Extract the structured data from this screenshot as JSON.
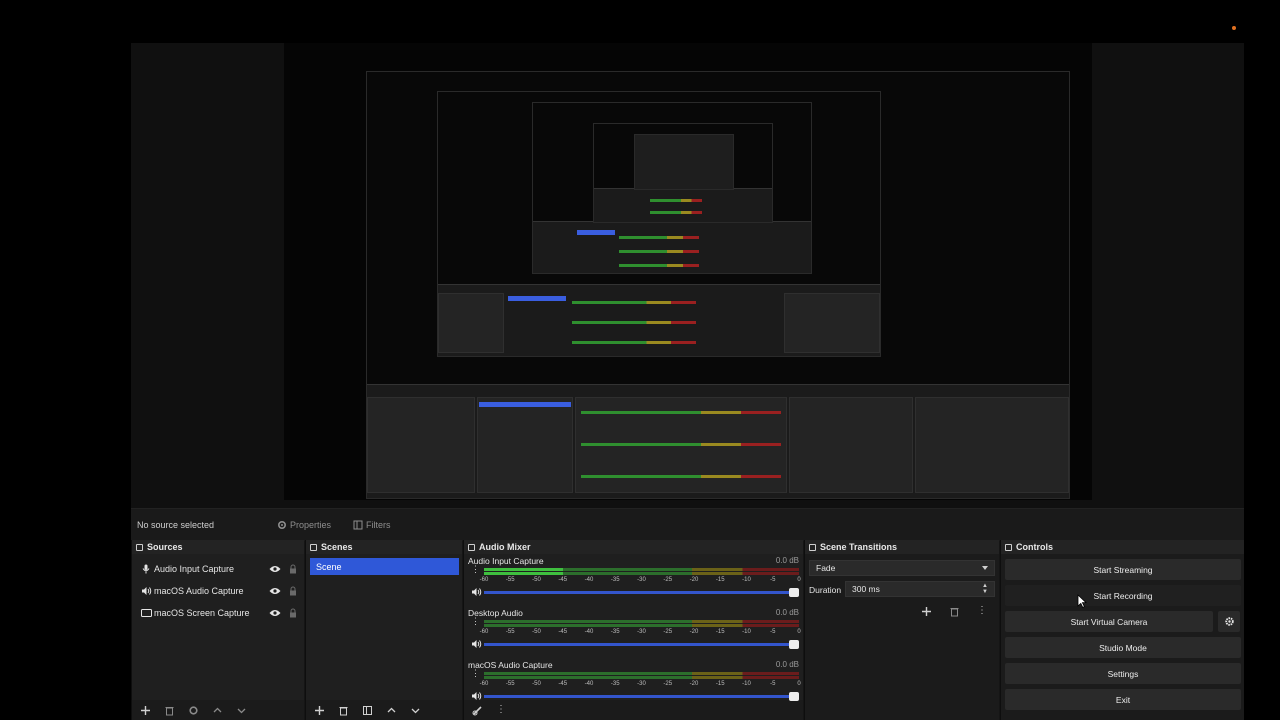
{
  "context_bar": {
    "no_source": "No source selected",
    "properties": "Properties",
    "filters": "Filters"
  },
  "docks": {
    "sources": {
      "title": "Sources"
    },
    "scenes": {
      "title": "Scenes"
    },
    "mixer": {
      "title": "Audio Mixer"
    },
    "transitions": {
      "title": "Scene Transitions"
    },
    "controls": {
      "title": "Controls"
    }
  },
  "sources": [
    {
      "label": "Audio Input Capture",
      "icon": "microphone-icon"
    },
    {
      "label": "macOS Audio Capture",
      "icon": "speaker-icon"
    },
    {
      "label": "macOS Screen Capture",
      "icon": "monitor-icon"
    }
  ],
  "scenes": [
    {
      "label": "Scene",
      "selected": true
    }
  ],
  "mixer": {
    "ticks": [
      "-60",
      "-55",
      "-50",
      "-45",
      "-40",
      "-35",
      "-30",
      "-25",
      "-20",
      "-15",
      "-10",
      "-5",
      "0"
    ],
    "channels": [
      {
        "name": "Audio Input Capture",
        "db": "0.0 dB",
        "level": 0.25
      },
      {
        "name": "Desktop Audio",
        "db": "0.0 dB",
        "level": 0
      },
      {
        "name": "macOS Audio Capture",
        "db": "0.0 dB",
        "level": 0
      }
    ]
  },
  "transitions": {
    "type": "Fade",
    "duration_label": "Duration",
    "duration_value": "300 ms"
  },
  "controls": {
    "start_streaming": "Start Streaming",
    "start_recording": "Start Recording",
    "start_virtual_camera": "Start Virtual Camera",
    "studio_mode": "Studio Mode",
    "settings": "Settings",
    "exit": "Exit"
  },
  "colors": {
    "accent": "#2f58d8",
    "background": "#151515",
    "panel": "#1b1b1b"
  }
}
